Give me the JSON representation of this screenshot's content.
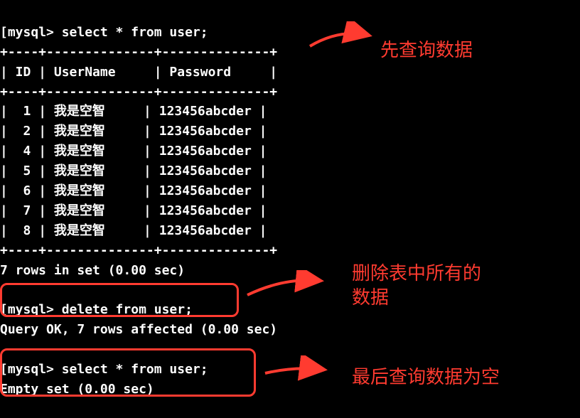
{
  "terminal": {
    "prompt_open": "[",
    "prompt_text": "mysql> ",
    "query1": "select * from user;",
    "table_border": "+----+----------+----------+",
    "table_header": "| ID | UserName | Password |",
    "rows": [
      {
        "id": "1",
        "username": "我是空智",
        "password": "123456abcder"
      },
      {
        "id": "2",
        "username": "我是空智",
        "password": "123456abcder"
      },
      {
        "id": "4",
        "username": "我是空智",
        "password": "123456abcder"
      },
      {
        "id": "5",
        "username": "我是空智",
        "password": "123456abcder"
      },
      {
        "id": "6",
        "username": "我是空智",
        "password": "123456abcder"
      },
      {
        "id": "7",
        "username": "我是空智",
        "password": "123456abcder"
      },
      {
        "id": "8",
        "username": "我是空智",
        "password": "123456abcder"
      }
    ],
    "result1": "7 rows in set (0.00 sec)",
    "query2": "delete from user;",
    "result2": "Query OK, 7 rows affected (0.00 sec)",
    "query3": "select * from user;",
    "result3": "Empty set (0.00 sec)"
  },
  "annotations": {
    "note1": "先查询数据",
    "note2_line1": "删除表中所有的",
    "note2_line2": "数据",
    "note3": "最后查询数据为空"
  }
}
